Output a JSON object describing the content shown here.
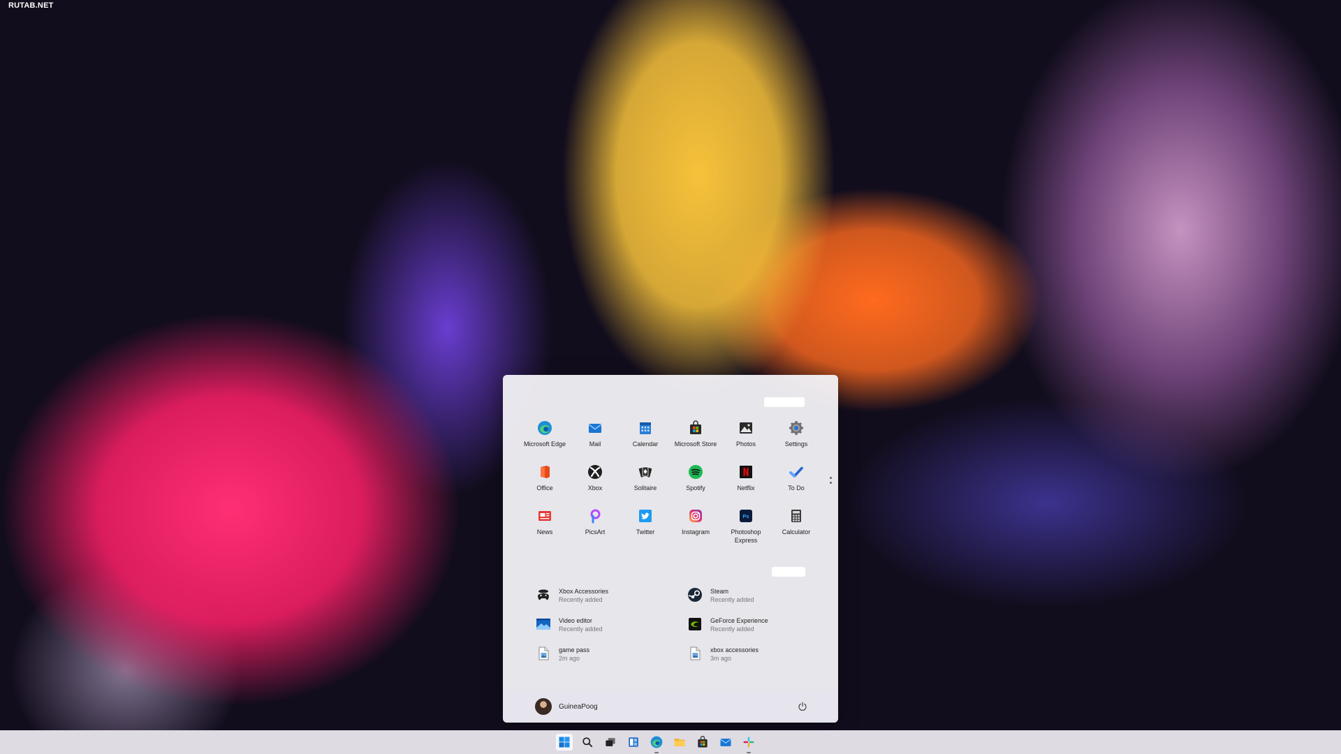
{
  "watermark": "RUTAB.NET",
  "start_menu": {
    "pinned_apps": [
      {
        "label": "Microsoft Edge",
        "icon": "edge-icon"
      },
      {
        "label": "Mail",
        "icon": "mail-icon"
      },
      {
        "label": "Calendar",
        "icon": "calendar-icon"
      },
      {
        "label": "Microsoft Store",
        "icon": "store-icon"
      },
      {
        "label": "Photos",
        "icon": "photos-icon"
      },
      {
        "label": "Settings",
        "icon": "settings-icon"
      },
      {
        "label": "Office",
        "icon": "office-icon"
      },
      {
        "label": "Xbox",
        "icon": "xbox-icon"
      },
      {
        "label": "Solitaire",
        "icon": "solitaire-icon"
      },
      {
        "label": "Spotify",
        "icon": "spotify-icon"
      },
      {
        "label": "Netflix",
        "icon": "netflix-icon"
      },
      {
        "label": "To Do",
        "icon": "todo-icon"
      },
      {
        "label": "News",
        "icon": "news-icon"
      },
      {
        "label": "PicsArt",
        "icon": "picsart-icon"
      },
      {
        "label": "Twitter",
        "icon": "twitter-icon"
      },
      {
        "label": "Instagram",
        "icon": "instagram-icon"
      },
      {
        "label": "Photoshop Express",
        "icon": "photoshop-express-icon"
      },
      {
        "label": "Calculator",
        "icon": "calculator-icon"
      }
    ],
    "recommended": [
      {
        "title": "Xbox Accessories",
        "subtitle": "Recently added",
        "icon": "xbox-accessories-icon"
      },
      {
        "title": "Steam",
        "subtitle": "Recently added",
        "icon": "steam-icon"
      },
      {
        "title": "Video editor",
        "subtitle": "Recently added",
        "icon": "video-editor-icon"
      },
      {
        "title": "GeForce Experience",
        "subtitle": "Recently added",
        "icon": "geforce-icon"
      },
      {
        "title": "game pass",
        "subtitle": "2m ago",
        "icon": "document-icon"
      },
      {
        "title": "xbox accessories",
        "subtitle": "3m ago",
        "icon": "document-icon"
      }
    ],
    "user": {
      "name": "GuineaPoog"
    }
  },
  "taskbar": {
    "icons": [
      {
        "name": "start-icon",
        "active": true,
        "running": false
      },
      {
        "name": "search-icon",
        "active": false,
        "running": false
      },
      {
        "name": "task-view-icon",
        "active": false,
        "running": false
      },
      {
        "name": "widgets-icon",
        "active": false,
        "running": false
      },
      {
        "name": "edge-icon",
        "active": false,
        "running": true
      },
      {
        "name": "file-explorer-icon",
        "active": false,
        "running": false
      },
      {
        "name": "store-icon",
        "active": false,
        "running": false
      },
      {
        "name": "mail-icon",
        "active": false,
        "running": false
      },
      {
        "name": "slack-icon",
        "active": false,
        "running": true
      }
    ]
  }
}
